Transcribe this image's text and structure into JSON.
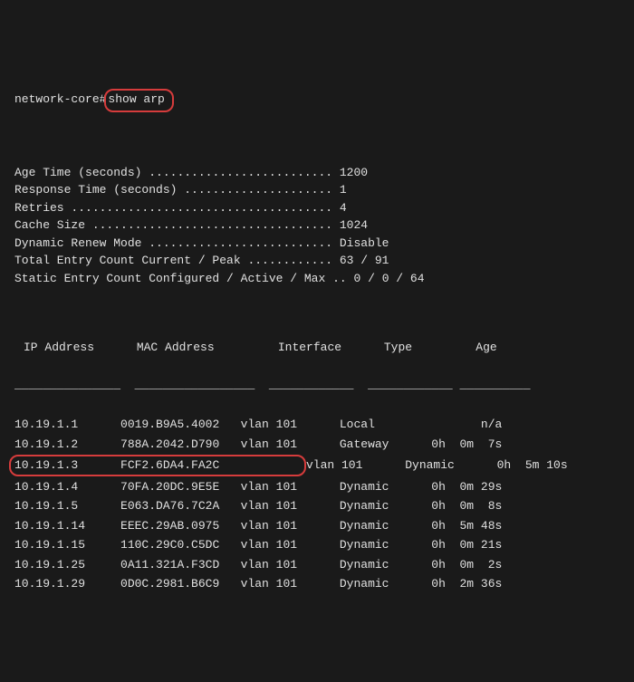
{
  "prompt": {
    "host": "network-core#",
    "command": "show arp"
  },
  "settings": [
    {
      "label": "Age Time (seconds)",
      "value": "1200"
    },
    {
      "label": "Response Time (seconds)",
      "value": "1"
    },
    {
      "label": "Retries",
      "value": "4"
    },
    {
      "label": "Cache Size",
      "value": "1024"
    },
    {
      "label": "Dynamic Renew Mode",
      "value": "Disable"
    },
    {
      "label": "Total Entry Count Current / Peak",
      "value": "63 / 91"
    },
    {
      "label": "Static Entry Count Configured / Active / Max",
      "value": "0 / 0 / 64"
    }
  ],
  "headers": {
    "ip": "IP Address",
    "mac": "MAC Address",
    "iface": "Interface",
    "type": "Type",
    "age": "Age"
  },
  "divider": {
    "c1": "_______________",
    "c2": "_________________",
    "c3": "____________",
    "c4": "____________",
    "c5": "__________"
  },
  "rows": [
    {
      "ip": "10.19.1.1",
      "mac": "0019.B9A5.4002",
      "iface": "vlan 101",
      "type": "Local",
      "age": "n/a",
      "hl": false
    },
    {
      "ip": "10.19.1.2",
      "mac": "788A.2042.D790",
      "iface": "vlan 101",
      "type": "Gateway",
      "age": "0h  0m  7s",
      "hl": false
    },
    {
      "ip": "10.19.1.3",
      "mac": "FCF2.6DA4.FA2C",
      "iface": "vlan 101",
      "type": "Dynamic",
      "age": "0h  5m 10s",
      "hl": true
    },
    {
      "ip": "10.19.1.4",
      "mac": "70FA.20DC.9E5E",
      "iface": "vlan 101",
      "type": "Dynamic",
      "age": "0h  0m 29s",
      "hl": false
    },
    {
      "ip": "10.19.1.5",
      "mac": "E063.DA76.7C2A",
      "iface": "vlan 101",
      "type": "Dynamic",
      "age": "0h  0m  8s",
      "hl": false
    },
    {
      "ip": "10.19.1.14",
      "mac": "EEEC.29AB.0975",
      "iface": "vlan 101",
      "type": "Dynamic",
      "age": "0h  5m 48s",
      "hl": false
    },
    {
      "ip": "10.19.1.15",
      "mac": "110C.29C0.C5DC",
      "iface": "vlan 101",
      "type": "Dynamic",
      "age": "0h  0m 21s",
      "hl": false
    },
    {
      "ip": "10.19.1.25",
      "mac": "0A11.321A.F3CD",
      "iface": "vlan 101",
      "type": "Dynamic",
      "age": "0h  0m  2s",
      "hl": false
    },
    {
      "ip": "10.19.1.29",
      "mac": "0D0C.2981.B6C9",
      "iface": "vlan 101",
      "type": "Dynamic",
      "age": "0h  2m 36s",
      "hl": false
    }
  ]
}
